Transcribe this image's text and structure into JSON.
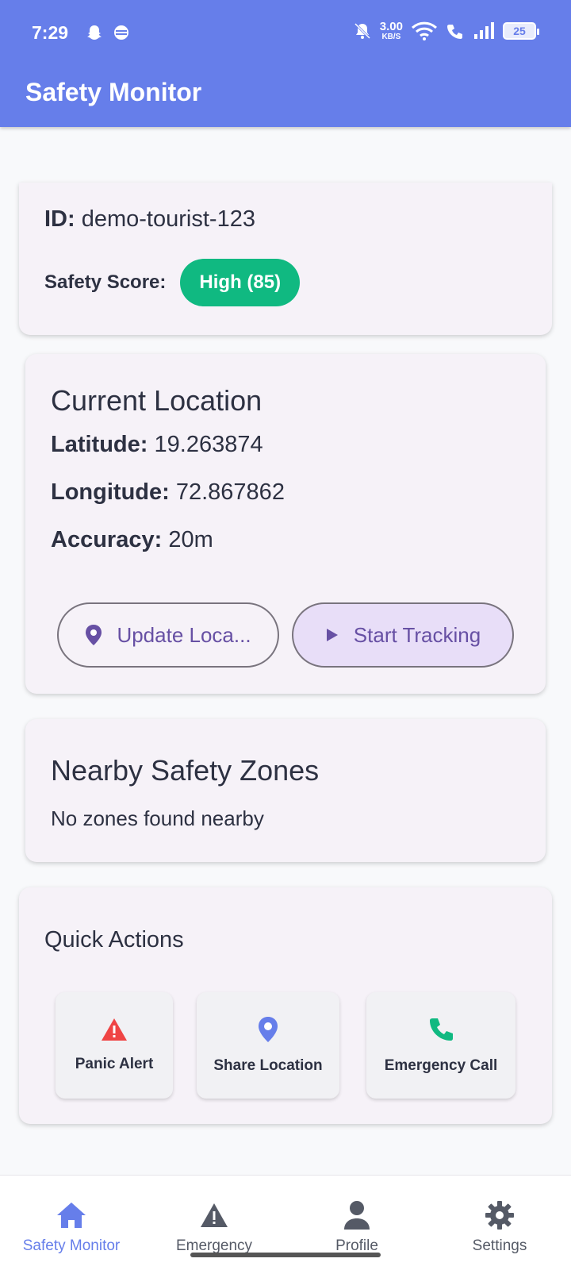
{
  "status_bar": {
    "time": "7:29",
    "speed_value": "3.00",
    "speed_unit": "KB/S",
    "battery": "25"
  },
  "app": {
    "title": "Safety Monitor",
    "accent": "#667eea"
  },
  "tourist": {
    "id_label": "ID:",
    "id_value": "demo-tourist-123",
    "safety_score_label": "Safety Score:",
    "safety_score_value": "High (85)",
    "safety_score_color": "#10b981"
  },
  "location": {
    "title": "Current Location",
    "latitude_label": "Latitude:",
    "latitude_value": "19.263874",
    "longitude_label": "Longitude:",
    "longitude_value": "72.867862",
    "accuracy_label": "Accuracy:",
    "accuracy_value": "20m",
    "update_button": "Update Loca...",
    "tracking_button": "Start Tracking"
  },
  "zones": {
    "title": "Nearby Safety Zones",
    "empty_text": "No zones found nearby"
  },
  "quick_actions": {
    "title": "Quick Actions",
    "items": [
      {
        "label": "Panic Alert",
        "icon": "warning-icon",
        "color": "#ef4444"
      },
      {
        "label": "Share Location",
        "icon": "location-pin-icon",
        "color": "#667eea"
      },
      {
        "label": "Emergency Call",
        "icon": "phone-icon",
        "color": "#10b981"
      }
    ]
  },
  "bottom_nav": {
    "items": [
      {
        "label": "Safety Monitor",
        "icon": "home-icon",
        "active": true
      },
      {
        "label": "Emergency",
        "icon": "warning-icon",
        "active": false
      },
      {
        "label": "Profile",
        "icon": "person-icon",
        "active": false
      },
      {
        "label": "Settings",
        "icon": "gear-icon",
        "active": false
      }
    ]
  }
}
